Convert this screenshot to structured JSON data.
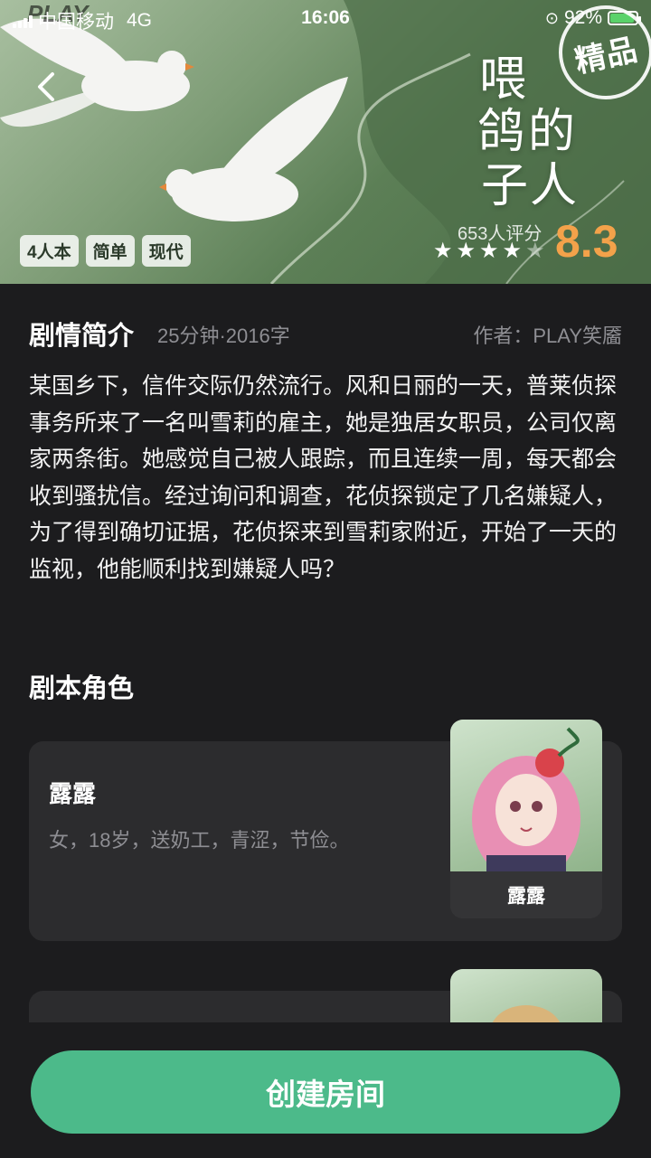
{
  "status_bar": {
    "carrier": "中国移动",
    "network": "4G",
    "time": "16:06",
    "battery": "92%"
  },
  "hero": {
    "watermark": "PLAY",
    "badge": "精品",
    "title": "喂鸽的子人",
    "rating_count": "653人评分",
    "score": "8.3",
    "stars_filled": 4,
    "stars_total": 5,
    "tags": [
      "4人本",
      "简单",
      "现代"
    ]
  },
  "intro": {
    "title": "剧情简介",
    "meta": "25分钟·2016字",
    "author": "作者：PLAY笑靥",
    "text": "某国乡下，信件交际仍然流行。风和日丽的一天，普莱侦探事务所来了一名叫雪莉的雇主，她是独居女职员，公司仅离家两条街。她感觉自己被人跟踪，而且连续一周，每天都会收到骚扰信。经过询问和调查，花侦探锁定了几名嫌疑人，为了得到确切证据，花侦探来到雪莉家附近，开始了一天的监视，他能顺利找到嫌疑人吗？"
  },
  "roles": {
    "title": "剧本角色",
    "items": [
      {
        "name": "露露",
        "desc": "女，18岁，送奶工，青涩，节俭。",
        "portrait_label": "露露"
      }
    ]
  },
  "action": {
    "create_label": "创建房间"
  },
  "colors": {
    "accent": "#4cba8a",
    "score": "#f3a24a",
    "background": "#1c1c1e",
    "card": "#2c2c2e"
  }
}
